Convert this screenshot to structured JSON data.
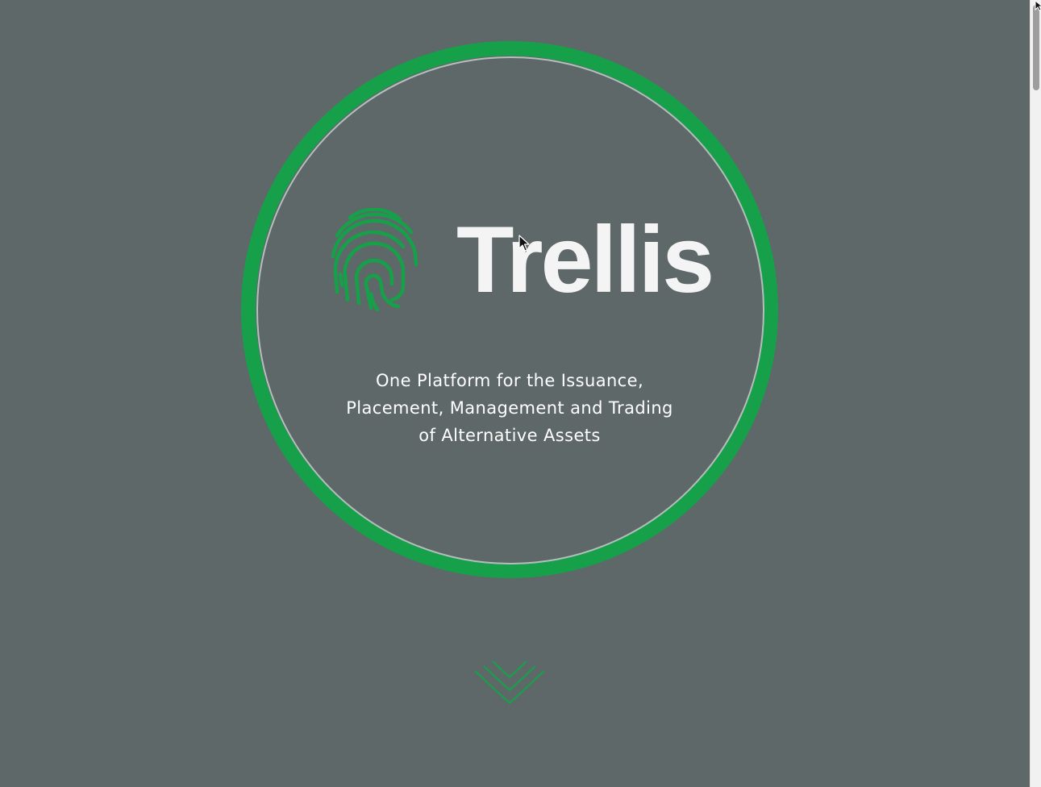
{
  "brand": {
    "name": "Trellis",
    "logo_icon": "fingerprint-icon"
  },
  "hero": {
    "tagline_lines": [
      "One Platform for the Issuance,",
      "Placement, Management and Trading",
      "of Alternative Assets"
    ],
    "scroll_icon": "triple-chevron-down-icon"
  },
  "colors": {
    "background": "#5e6869",
    "accent_green": "#17a04a",
    "ring_inner": "#b4bfbd",
    "text": "#ffffff"
  }
}
